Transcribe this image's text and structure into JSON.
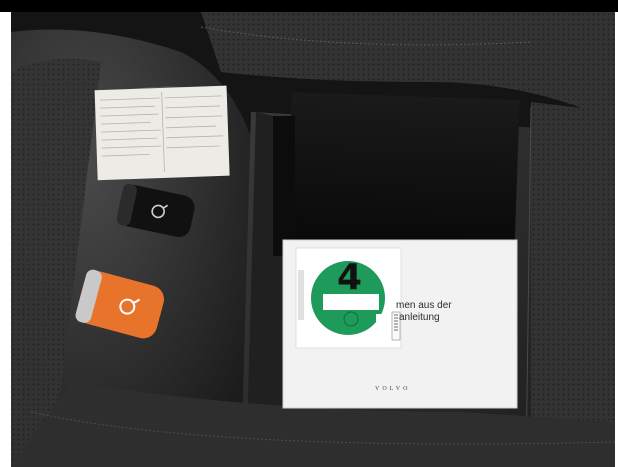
{
  "photo": {
    "subject": "Vehicle documents and keys on a seat",
    "colors": {
      "seat_leather": "#2a2a2a",
      "seat_perforated": "#3a3a3a",
      "orange_key": "#e8742b",
      "black_key": "#151515",
      "sticker_green": "#1e9a5a",
      "manual_page": "#f2f2f2",
      "folder_black": "#0e0e0e"
    },
    "sticker": {
      "number": "4"
    },
    "manual": {
      "line1": "men aus der",
      "line2": "anleitung",
      "brand": "VOLVO"
    }
  }
}
